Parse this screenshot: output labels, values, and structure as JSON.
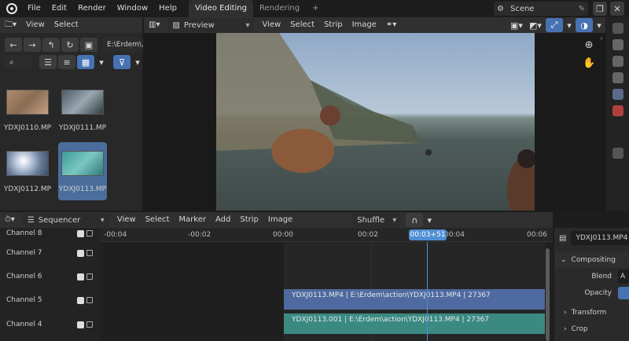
{
  "topbar": {
    "menus": [
      "File",
      "Edit",
      "Render",
      "Window",
      "Help"
    ],
    "workspaces": [
      {
        "label": "Video Editing",
        "active": true
      },
      {
        "label": "Rendering",
        "active": false
      }
    ],
    "add_tab": "+",
    "scene": "Scene"
  },
  "file_browser": {
    "menus": [
      "View",
      "Select"
    ],
    "path": "E:\\Erdem\\...",
    "files": [
      {
        "name": "YDXJ0110.MP",
        "selected": false
      },
      {
        "name": "YDXJ0111.MP",
        "selected": false
      },
      {
        "name": "YDXJ0112.MP",
        "selected": false
      },
      {
        "name": "YDXJ0113.MP",
        "selected": true
      }
    ]
  },
  "preview": {
    "mode": "Preview",
    "menus": [
      "View",
      "Select",
      "Strip",
      "Image"
    ]
  },
  "sequencer": {
    "editor": "Sequencer",
    "menus": [
      "View",
      "Select",
      "Marker",
      "Add",
      "Strip",
      "Image"
    ],
    "snap": "Shuffle",
    "ruler": [
      "-00:04",
      "-00:02",
      "00:00",
      "00:02",
      "00:04",
      "00:06"
    ],
    "playhead": "00:03+51",
    "channels": [
      "Channel 8",
      "Channel 7",
      "Channel 6",
      "Channel 5",
      "Channel 4"
    ],
    "strips": [
      {
        "label": "YDXJ0113.MP4 | E:\\Erdem\\action\\YDXJ0113.MP4 | 27367",
        "channel": "Channel 5"
      },
      {
        "label": "YDXJ0113.001 | E:\\Erdem\\action\\YDXJ0113.MP4 | 27367",
        "channel": "Channel 4"
      }
    ]
  },
  "properties": {
    "strip_name": "YDXJ0113.MP4",
    "sections": {
      "compositing": "Compositing",
      "blend_label": "Blend",
      "blend_value": "A",
      "opacity_label": "Opacity",
      "transform": "Transform",
      "crop": "Crop"
    }
  },
  "colors": {
    "accent": "#4772b3",
    "movie_strip": "#4e6aa0",
    "sound_strip": "#3a8a82",
    "playhead": "#4f8fd6"
  }
}
